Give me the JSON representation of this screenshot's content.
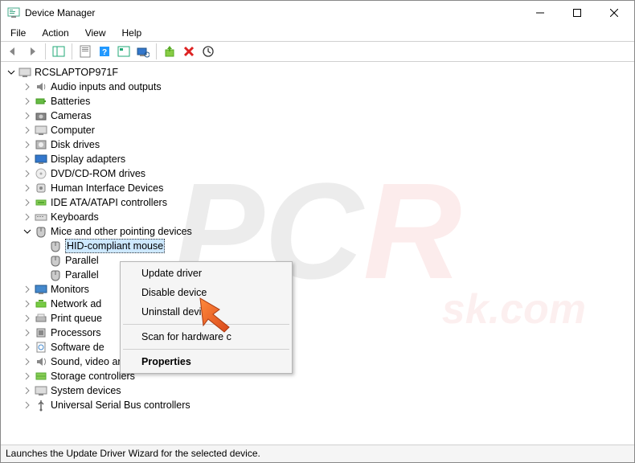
{
  "window": {
    "title": "Device Manager"
  },
  "menubar": [
    "File",
    "Action",
    "View",
    "Help"
  ],
  "tree": {
    "root": "RCSLAPTOP971F",
    "nodes": [
      {
        "label": "Audio inputs and outputs",
        "icon": "speaker"
      },
      {
        "label": "Batteries",
        "icon": "battery"
      },
      {
        "label": "Cameras",
        "icon": "camera"
      },
      {
        "label": "Computer",
        "icon": "computer"
      },
      {
        "label": "Disk drives",
        "icon": "disk"
      },
      {
        "label": "Display adapters",
        "icon": "display"
      },
      {
        "label": "DVD/CD-ROM drives",
        "icon": "cd"
      },
      {
        "label": "Human Interface Devices",
        "icon": "hid"
      },
      {
        "label": "IDE ATA/ATAPI controllers",
        "icon": "ide"
      },
      {
        "label": "Keyboards",
        "icon": "keyboard"
      },
      {
        "label": "Mice and other pointing devices",
        "icon": "mouse",
        "expanded": true,
        "children": [
          {
            "label": "HID-compliant mouse",
            "icon": "mouse",
            "selected": true
          },
          {
            "label": "Parallel",
            "icon": "mouse",
            "truncated": true
          },
          {
            "label": "Parallel",
            "icon": "mouse",
            "truncated": true
          }
        ]
      },
      {
        "label": "Monitors",
        "icon": "monitor"
      },
      {
        "label": "Network ad",
        "icon": "network",
        "truncated": true
      },
      {
        "label": "Print queue",
        "icon": "printer",
        "truncated": true
      },
      {
        "label": "Processors",
        "icon": "cpu"
      },
      {
        "label": "Software de",
        "icon": "software",
        "truncated": true
      },
      {
        "label": "Sound, video and game controllers",
        "icon": "sound"
      },
      {
        "label": "Storage controllers",
        "icon": "storage"
      },
      {
        "label": "System devices",
        "icon": "system"
      },
      {
        "label": "Universal Serial Bus controllers",
        "icon": "usb"
      }
    ]
  },
  "context_menu": {
    "items": [
      {
        "label": "Update driver"
      },
      {
        "label": "Disable device"
      },
      {
        "label": "Uninstall device"
      },
      {
        "sep": true
      },
      {
        "label": "Scan for hardware changes",
        "display": "Scan for hardware c"
      },
      {
        "sep": true
      },
      {
        "label": "Properties",
        "bold": true
      }
    ]
  },
  "statusbar": "Launches the Update Driver Wizard for the selected device.",
  "watermark": {
    "main": "PC",
    "accent": "R",
    "sub": "sk.com"
  }
}
